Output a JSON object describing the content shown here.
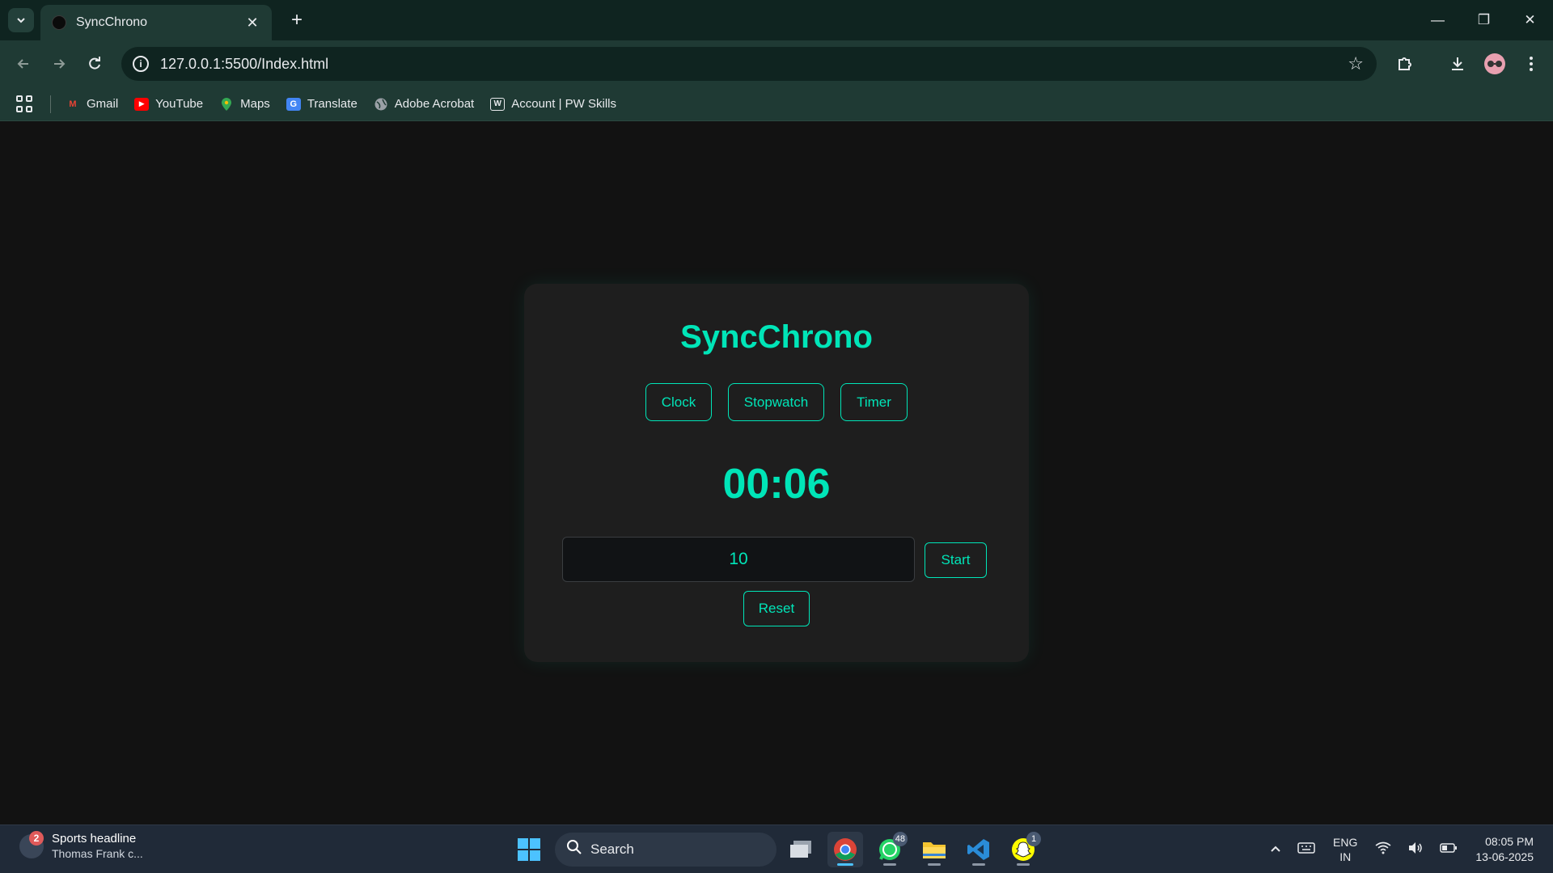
{
  "browser": {
    "tab_title": "SyncChrono",
    "url": "127.0.0.1:5500/Index.html",
    "bookmarks": [
      {
        "label": "Gmail",
        "icon": "gmail-icon",
        "color": "#ea4335"
      },
      {
        "label": "YouTube",
        "icon": "youtube-icon",
        "color": "#ff0000"
      },
      {
        "label": "Maps",
        "icon": "maps-icon",
        "color": "#34a853"
      },
      {
        "label": "Translate",
        "icon": "translate-icon",
        "color": "#4285f4"
      },
      {
        "label": "Adobe Acrobat",
        "icon": "globe-icon",
        "color": "#9aa0a6"
      },
      {
        "label": "Account | PW Skills",
        "icon": "pw-skills-icon",
        "color": "#e8eaed"
      }
    ]
  },
  "app": {
    "title": "SyncChrono",
    "accent_color": "#00e5b8",
    "modes": [
      {
        "label": "Clock"
      },
      {
        "label": "Stopwatch"
      },
      {
        "label": "Timer"
      }
    ],
    "time_display": "00:06",
    "timer_input_value": "10",
    "start_label": "Start",
    "reset_label": "Reset"
  },
  "taskbar": {
    "widget_headline": "Sports headline",
    "widget_sub": "Thomas Frank c...",
    "widget_badge": "2",
    "search_placeholder": "Search",
    "whatsapp_badge": "48",
    "snapchat_badge": "1",
    "lang_line1": "ENG",
    "lang_line2": "IN",
    "time": "08:05 PM",
    "date": "13-06-2025"
  }
}
